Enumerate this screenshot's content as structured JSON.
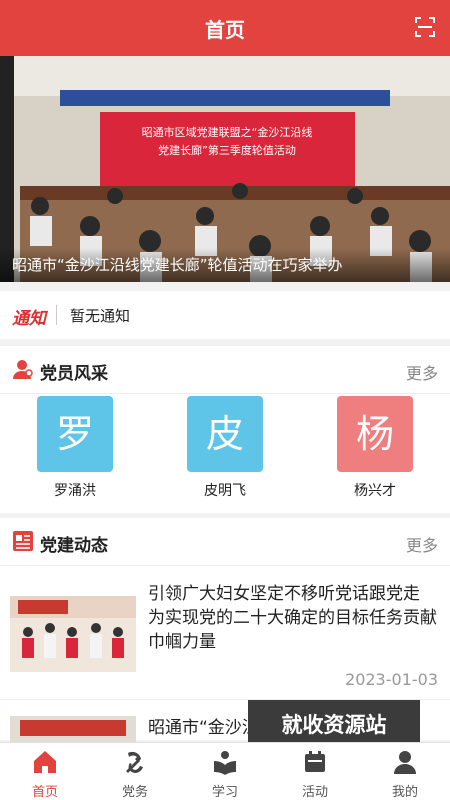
{
  "header": {
    "title": "首页",
    "scan_icon": "scan-icon"
  },
  "banner": {
    "caption": "昭通市“金沙江沿线党建长廊”轮值活动在巧家举办",
    "photo_subject": "meeting hall with red banner and seated attendees",
    "stage_banner_line1": "昭通市区域党建联盟之“金沙江沿线",
    "stage_banner_line2": "党建长廊”第三季度轮值活动"
  },
  "notice": {
    "tag": "通知",
    "text": "暂无通知"
  },
  "members_section": {
    "title": "党员风采",
    "icon": "person-icon",
    "more_label": "更多",
    "members": [
      {
        "avatar_char": "罗",
        "name": "罗涌洪",
        "color": "#5ec4e8"
      },
      {
        "avatar_char": "皮",
        "name": "皮明飞",
        "color": "#5ec4e8"
      },
      {
        "avatar_char": "杨",
        "name": "杨兴才",
        "color": "#ef7f7f"
      }
    ]
  },
  "news_section": {
    "title": "党建动态",
    "icon": "news-icon",
    "more_label": "更多",
    "items": [
      {
        "title": "引领广大妇女坚定不移听党话跟党走 为实现党的二十大确定的目标任务贡献巾帼力量",
        "date": "2023-01-03"
      },
      {
        "title": "昭通市“金沙江沿线党建长廊”轮",
        "date": ""
      }
    ]
  },
  "watermark": {
    "text": "就收资源站"
  },
  "tabbar": {
    "items": [
      {
        "label": "首页",
        "icon": "home-icon",
        "active": true
      },
      {
        "label": "党务",
        "icon": "party-emblem-icon",
        "active": false
      },
      {
        "label": "学习",
        "icon": "study-icon",
        "active": false
      },
      {
        "label": "活动",
        "icon": "activity-icon",
        "active": false
      },
      {
        "label": "我的",
        "icon": "profile-icon",
        "active": false
      }
    ]
  },
  "colors": {
    "accent": "#e2433f",
    "notice_red": "#d93030",
    "muted": "#999999"
  }
}
